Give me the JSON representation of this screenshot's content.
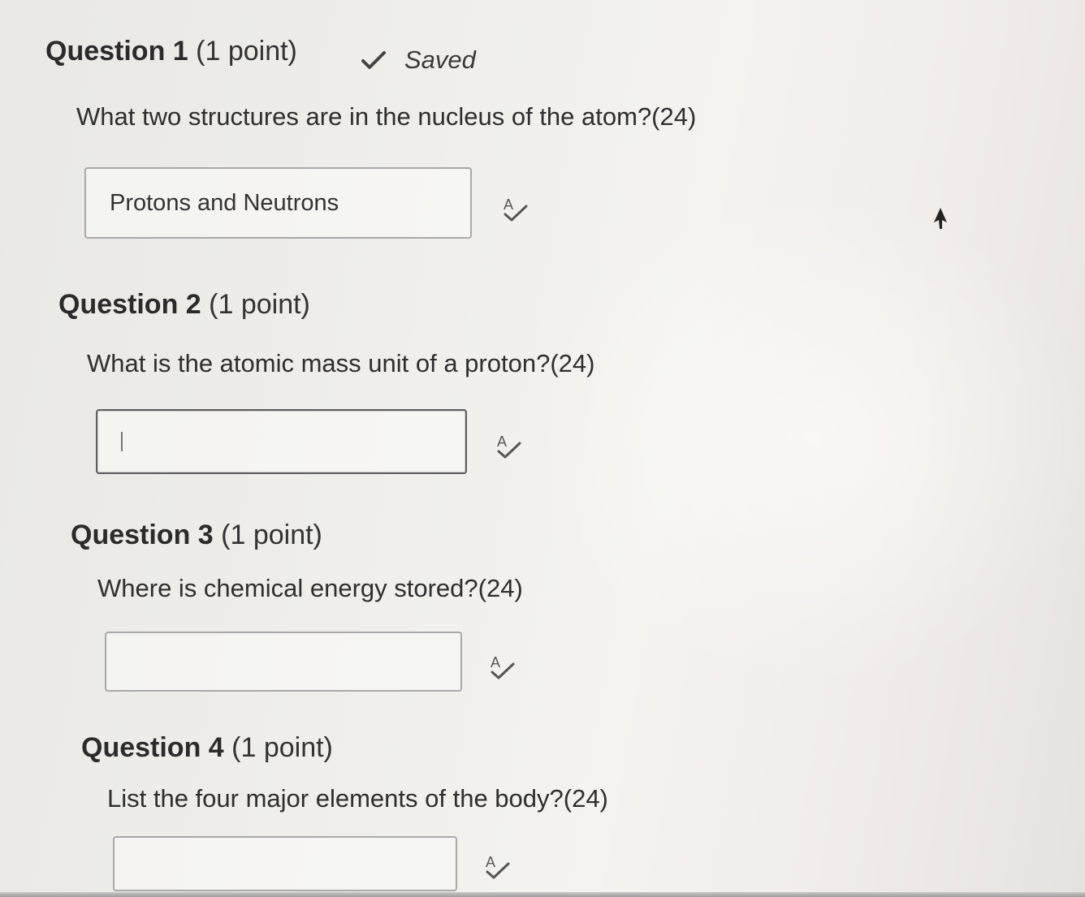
{
  "questions": [
    {
      "number_label": "Question 1",
      "points_label": "(1 point)",
      "status": "Saved",
      "prompt": "What two structures are in the nucleus of the atom?(24)",
      "answer": "Protons and Neutrons"
    },
    {
      "number_label": "Question 2",
      "points_label": "(1 point)",
      "prompt": "What is the atomic mass unit of a proton?(24)",
      "answer": ""
    },
    {
      "number_label": "Question 3",
      "points_label": "(1 point)",
      "prompt": "Where is chemical energy stored?(24)",
      "answer": ""
    },
    {
      "number_label": "Question 4",
      "points_label": "(1 point)",
      "prompt": "List the four major elements of the body?(24)",
      "answer": ""
    }
  ],
  "icons": {
    "saved": "checkmark-icon",
    "spellcheck": "spellcheck-icon",
    "pointer": "mouse-pointer-icon"
  },
  "colors": {
    "text": "#2a2a2a",
    "input_border": "#a9a9a9",
    "focused_border": "#5f5f5f"
  }
}
